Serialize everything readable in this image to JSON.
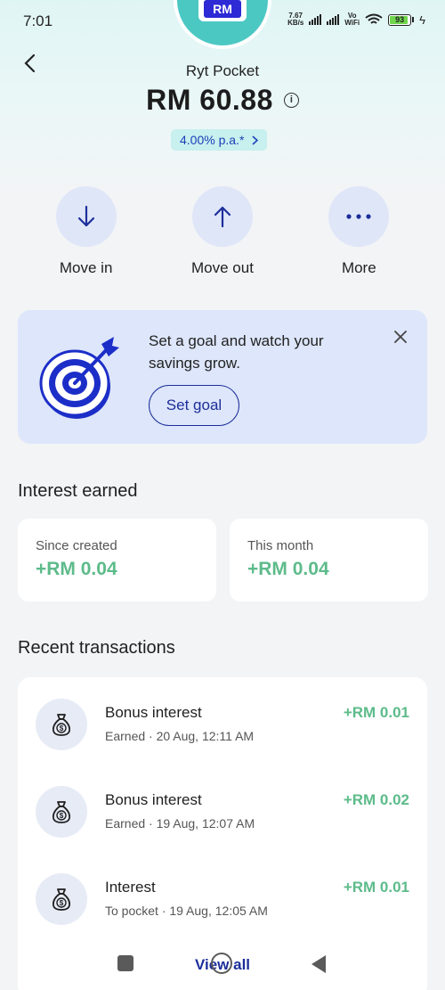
{
  "status_bar": {
    "time": "7:01",
    "net_speed_value": "7.67",
    "net_speed_unit": "KB/s",
    "vowifi_top": "Vo",
    "vowifi_bottom": "WiFi",
    "battery": "93"
  },
  "avatar": {
    "label": "RM"
  },
  "header": {
    "pocket_name": "Ryt Pocket",
    "balance": "RM 60.88",
    "info_icon": "i",
    "rate": "4.00% p.a.*"
  },
  "actions": {
    "move_in": "Move in",
    "move_out": "Move out",
    "more": "More"
  },
  "goal_card": {
    "text": "Set a goal and watch your savings grow.",
    "button": "Set goal"
  },
  "interest": {
    "title": "Interest earned",
    "since_created_label": "Since created",
    "since_created_value": "+RM 0.04",
    "this_month_label": "This month",
    "this_month_value": "+RM 0.04"
  },
  "transactions": {
    "title": "Recent transactions",
    "items": [
      {
        "title": "Bonus interest",
        "subtitle": "Earned · 20 Aug, 12:11 AM",
        "amount": "+RM 0.01"
      },
      {
        "title": "Bonus interest",
        "subtitle": "Earned · 19 Aug, 12:07 AM",
        "amount": "+RM 0.02"
      },
      {
        "title": "Interest",
        "subtitle": "To pocket · 19 Aug, 12:05 AM",
        "amount": "+RM 0.01"
      }
    ],
    "view_all": "View all"
  },
  "colors": {
    "accent": "#1c2e9a",
    "positive": "#5dbb8a",
    "card_blue": "#dde6fa",
    "rate_pill": "#c7f0ef"
  }
}
